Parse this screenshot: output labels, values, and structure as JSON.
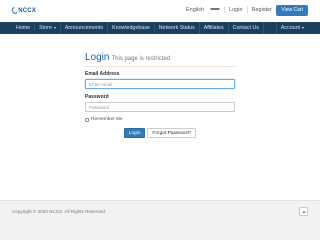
{
  "brand": {
    "logo_text": "NCCX"
  },
  "header": {
    "language": "English",
    "login": "Login",
    "register": "Register",
    "view_cart": "View Cart"
  },
  "nav": {
    "items": [
      "Home",
      "Store",
      "Announcements",
      "Knowledgebase",
      "Network Status",
      "Affiliates",
      "Contact Us"
    ],
    "account": "Account"
  },
  "login": {
    "title": "Login",
    "subtitle": "This page is restricted",
    "email_label": "Email Address",
    "email_placeholder": "Enter email",
    "password_label": "Password",
    "password_placeholder": "Password",
    "remember_me": "Remember Me",
    "login_button": "Login",
    "forgot_button": "Forgot Password?"
  },
  "footer": {
    "copyright": "Copyright © 2020 NCCX. All Rights Reserved."
  },
  "colors": {
    "navbar": "#1c3f60",
    "primary": "#337ab7",
    "title": "#1e5aa8"
  }
}
